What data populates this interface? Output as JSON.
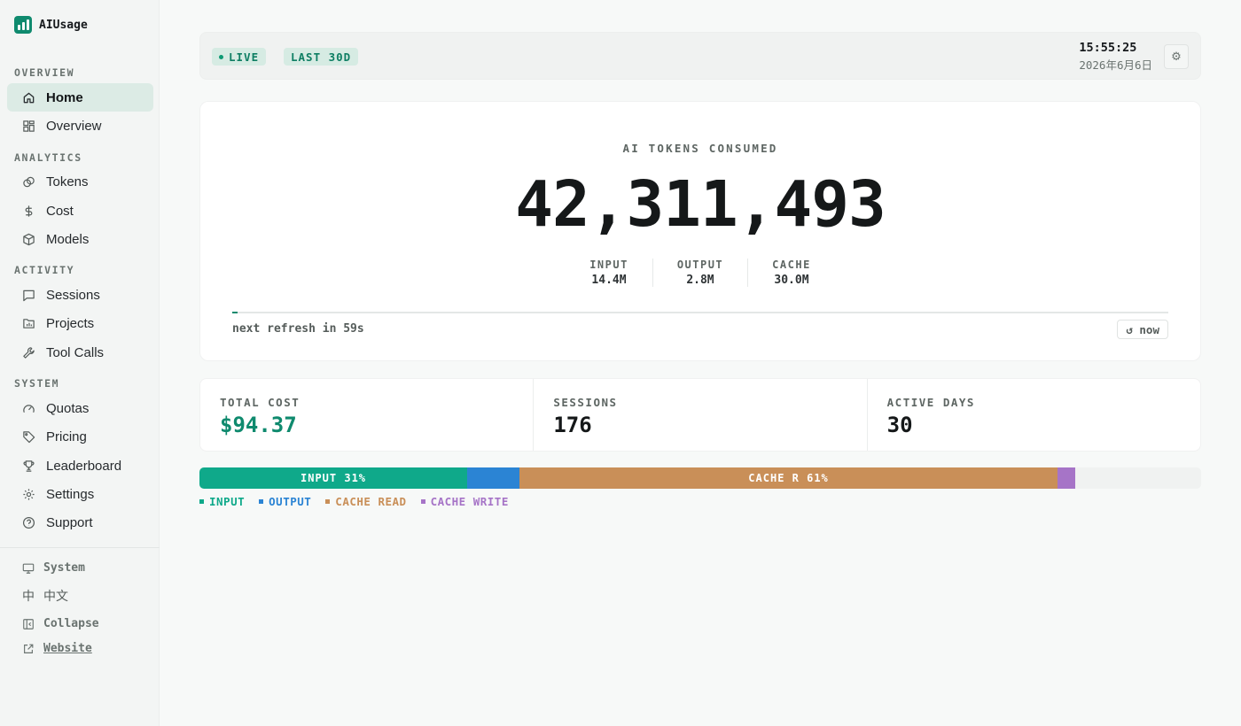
{
  "app": {
    "name": "AIUsage"
  },
  "sidebar": {
    "sections": [
      {
        "label": "OVERVIEW",
        "items": [
          {
            "label": "Home",
            "icon": "home-icon",
            "active": true
          },
          {
            "label": "Overview",
            "icon": "grid-icon"
          }
        ]
      },
      {
        "label": "ANALYTICS",
        "items": [
          {
            "label": "Tokens",
            "icon": "coins-icon"
          },
          {
            "label": "Cost",
            "icon": "dollar-icon"
          },
          {
            "label": "Models",
            "icon": "cube-icon"
          }
        ]
      },
      {
        "label": "ACTIVITY",
        "items": [
          {
            "label": "Sessions",
            "icon": "message-icon"
          },
          {
            "label": "Projects",
            "icon": "folder-chart-icon"
          },
          {
            "label": "Tool Calls",
            "icon": "wrench-icon"
          }
        ]
      },
      {
        "label": "SYSTEM",
        "items": [
          {
            "label": "Quotas",
            "icon": "gauge-icon"
          },
          {
            "label": "Pricing",
            "icon": "tag-icon"
          },
          {
            "label": "Leaderboard",
            "icon": "trophy-icon"
          },
          {
            "label": "Settings",
            "icon": "gear-icon"
          },
          {
            "label": "Support",
            "icon": "help-icon"
          }
        ]
      }
    ],
    "footer": {
      "system": "System",
      "lang_icon": "中",
      "language": "中文",
      "collapse": "Collapse",
      "website": "Website"
    }
  },
  "header": {
    "live": "LIVE",
    "range": "LAST 30D",
    "time": "15:55:25",
    "date": "2026年6月6日"
  },
  "hero": {
    "label": "AI TOKENS CONSUMED",
    "total": "42,311,493",
    "breakdown": [
      {
        "key": "INPUT",
        "value": "14.4M"
      },
      {
        "key": "OUTPUT",
        "value": "2.8M"
      },
      {
        "key": "CACHE",
        "value": "30.0M"
      }
    ],
    "refresh_progress": 0.006,
    "refresh_text": "next refresh in 59s",
    "now_button": "↺ now"
  },
  "stats": [
    {
      "key": "TOTAL COST",
      "value": "$94.37",
      "accent": true
    },
    {
      "key": "SESSIONS",
      "value": "176"
    },
    {
      "key": "ACTIVE DAYS",
      "value": "30"
    }
  ],
  "token_split": {
    "segments": [
      {
        "name": "INPUT",
        "fraction": 0.2673,
        "color": "#0fa98a",
        "label": "INPUT 31%"
      },
      {
        "name": "OUTPUT",
        "fraction": 0.0522,
        "color": "#2b84d4",
        "label": ""
      },
      {
        "name": "CACHE READ",
        "fraction": 0.5372,
        "color": "#c98f58",
        "label": "CACHE R 61%"
      },
      {
        "name": "CACHE WRITE",
        "fraction": 0.0177,
        "color": "#a674c7",
        "label": ""
      }
    ],
    "legend": [
      {
        "label": "INPUT",
        "color": "#0fa98a"
      },
      {
        "label": "OUTPUT",
        "color": "#2b84d4"
      },
      {
        "label": "CACHE READ",
        "color": "#c98f58"
      },
      {
        "label": "CACHE WRITE",
        "color": "#a674c7"
      }
    ]
  }
}
